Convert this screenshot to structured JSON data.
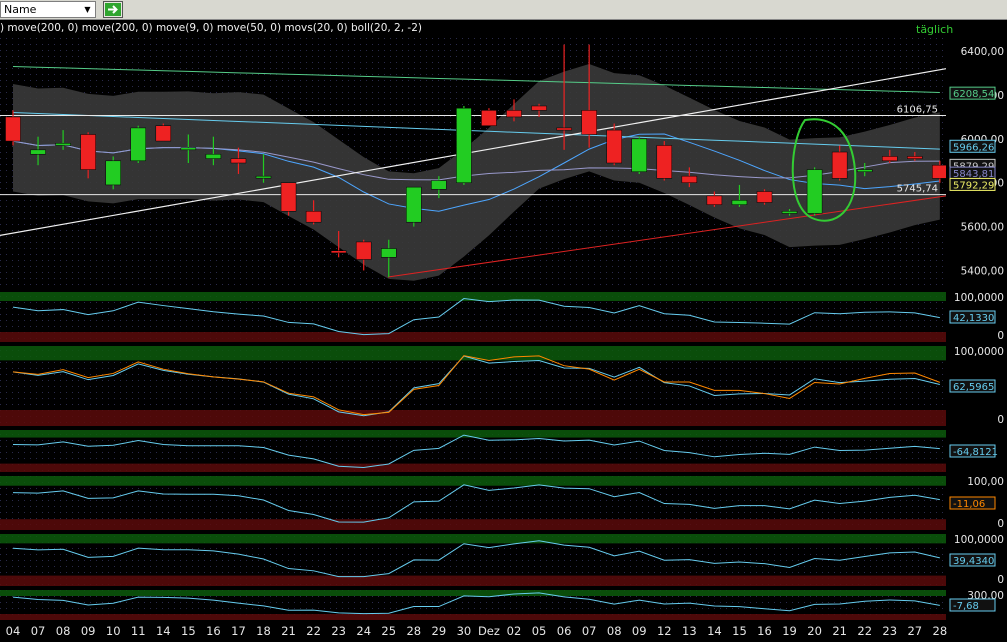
{
  "toolbar": {
    "name_select_value": "Name",
    "go_icon": "green-arrow-right-icon"
  },
  "indicator_line": ") move(200, 0) move(200, 0) move(9, 0) move(50, 0) movs(20, 0) boll(20, 2, -2)",
  "period_label": "täglich",
  "colors": {
    "background": "#000000",
    "up_candle": "#22cc22",
    "down_candle": "#ee2222",
    "band": "#3a3a3a",
    "accent_green": "#33cc33"
  },
  "chart_data": {
    "type": "candlestick",
    "x_labels": [
      "04",
      "07",
      "08",
      "09",
      "10",
      "11",
      "14",
      "15",
      "16",
      "17",
      "18",
      "21",
      "22",
      "23",
      "24",
      "25",
      "28",
      "29",
      "30",
      "Dez",
      "02",
      "05",
      "06",
      "07",
      "08",
      "09",
      "12",
      "13",
      "14",
      "15",
      "16",
      "19",
      "20",
      "21",
      "22",
      "23",
      "27",
      "28"
    ],
    "ohlc": [
      {
        "o": 6100,
        "h": 6130,
        "l": 5970,
        "c": 5990
      },
      {
        "o": 5930,
        "h": 6010,
        "l": 5880,
        "c": 5950
      },
      {
        "o": 5970,
        "h": 6040,
        "l": 5950,
        "c": 5980
      },
      {
        "o": 6020,
        "h": 6030,
        "l": 5820,
        "c": 5860
      },
      {
        "o": 5790,
        "h": 5920,
        "l": 5770,
        "c": 5900
      },
      {
        "o": 5900,
        "h": 6060,
        "l": 5890,
        "c": 6050
      },
      {
        "o": 6060,
        "h": 6070,
        "l": 5990,
        "c": 5990
      },
      {
        "o": 5950,
        "h": 6020,
        "l": 5890,
        "c": 5960
      },
      {
        "o": 5910,
        "h": 6010,
        "l": 5880,
        "c": 5930
      },
      {
        "o": 5910,
        "h": 5960,
        "l": 5840,
        "c": 5890
      },
      {
        "o": 5830,
        "h": 5930,
        "l": 5800,
        "c": 5830
      },
      {
        "o": 5800,
        "h": 5800,
        "l": 5650,
        "c": 5670
      },
      {
        "o": 5670,
        "h": 5720,
        "l": 5610,
        "c": 5620
      },
      {
        "o": 5490,
        "h": 5580,
        "l": 5460,
        "c": 5480
      },
      {
        "o": 5530,
        "h": 5540,
        "l": 5400,
        "c": 5450
      },
      {
        "o": 5460,
        "h": 5540,
        "l": 5370,
        "c": 5500
      },
      {
        "o": 5620,
        "h": 5780,
        "l": 5600,
        "c": 5780
      },
      {
        "o": 5770,
        "h": 5830,
        "l": 5730,
        "c": 5810
      },
      {
        "o": 5800,
        "h": 6150,
        "l": 5790,
        "c": 6140
      },
      {
        "o": 6130,
        "h": 6140,
        "l": 6060,
        "c": 6060
      },
      {
        "o": 6130,
        "h": 6180,
        "l": 6080,
        "c": 6100
      },
      {
        "o": 6150,
        "h": 6160,
        "l": 6100,
        "c": 6130
      },
      {
        "o": 6050,
        "h": 6430,
        "l": 5950,
        "c": 6040
      },
      {
        "o": 6130,
        "h": 6430,
        "l": 5960,
        "c": 6020
      },
      {
        "o": 6040,
        "h": 6070,
        "l": 5880,
        "c": 5890
      },
      {
        "o": 5850,
        "h": 6010,
        "l": 5840,
        "c": 6000
      },
      {
        "o": 5970,
        "h": 5990,
        "l": 5810,
        "c": 5820
      },
      {
        "o": 5830,
        "h": 5870,
        "l": 5780,
        "c": 5800
      },
      {
        "o": 5740,
        "h": 5760,
        "l": 5690,
        "c": 5700
      },
      {
        "o": 5700,
        "h": 5790,
        "l": 5690,
        "c": 5720
      },
      {
        "o": 5760,
        "h": 5770,
        "l": 5700,
        "c": 5710
      },
      {
        "o": 5660,
        "h": 5680,
        "l": 5650,
        "c": 5670
      },
      {
        "o": 5660,
        "h": 5870,
        "l": 5650,
        "c": 5860
      },
      {
        "o": 5940,
        "h": 5970,
        "l": 5810,
        "c": 5820
      },
      {
        "o": 5850,
        "h": 5890,
        "l": 5830,
        "c": 5860
      },
      {
        "o": 5920,
        "h": 5950,
        "l": 5890,
        "c": 5900
      },
      {
        "o": 5920,
        "h": 5940,
        "l": 5900,
        "c": 5910
      },
      {
        "o": 5880,
        "h": 5900,
        "l": 5800,
        "c": 5820
      }
    ],
    "y_ticks": [
      5400,
      5600,
      5800,
      6000,
      6200,
      6400
    ],
    "y_tick_labels": [
      "5400,00",
      "5600,00",
      "5800,00",
      "6000,00",
      "6200,00",
      "6400,00"
    ],
    "ylim": [
      5320,
      6460
    ],
    "level_lines": [
      {
        "value": 6106.75,
        "label": "6106,75"
      },
      {
        "value": 5745.74,
        "label": "5745,74"
      }
    ],
    "price_tags": [
      {
        "value": 6208.54,
        "label": "6208,54",
        "color": "#55cc88"
      },
      {
        "value": 5966.26,
        "label": "5966,26",
        "color": "#66ccee"
      },
      {
        "value": 5879.29,
        "label": "5879,29",
        "color": "#cccccc"
      },
      {
        "value": 5843.81,
        "label": "5843,81",
        "color": "#8888cc"
      },
      {
        "value": 5792.29,
        "label": "5792,29",
        "color": "#eeee66"
      }
    ],
    "panels": [
      {
        "name": "panel-1",
        "ticks": [
          "100,0000",
          "0"
        ],
        "value_label": "42,1330",
        "tag_color": "#66ccee"
      },
      {
        "name": "panel-2",
        "ticks": [
          "100,0000",
          "0"
        ],
        "value_label": "62,5965",
        "tag_color": "#66ccee"
      },
      {
        "name": "panel-3",
        "ticks": [],
        "value_label": "-64,8121",
        "tag_color": "#66ccee"
      },
      {
        "name": "panel-4",
        "ticks": [
          "100,00",
          "0"
        ],
        "value_label": "-11,06",
        "tag_color": "#ff8800"
      },
      {
        "name": "panel-5",
        "ticks": [
          "100,0000",
          "0"
        ],
        "value_label": "39,4340",
        "tag_color": "#66ccee"
      },
      {
        "name": "panel-6",
        "ticks": [
          "300,00"
        ],
        "value_label": "-7,68",
        "tag_color": "#66ccee"
      }
    ]
  }
}
